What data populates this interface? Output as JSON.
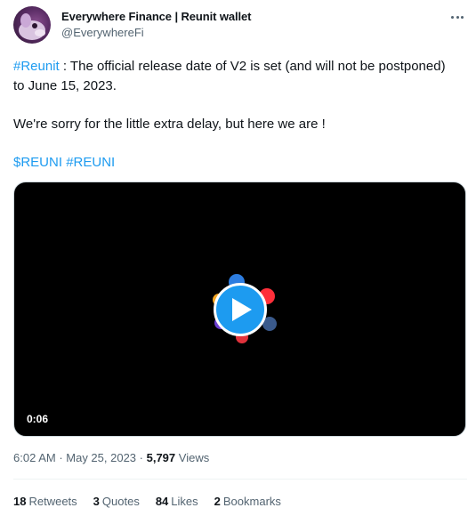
{
  "author": {
    "name": "Everywhere Finance | Reunit wallet",
    "handle": "@EverywhereFi",
    "avatar_icon": "wallet-mascot-avatar"
  },
  "menu": {
    "icon": "more-options-icon"
  },
  "tweet": {
    "hashtag": "#Reunit",
    "line1_rest": " : The official release date of V2 is set (and will not be postponed) to June 15, 2023.",
    "line2": "We're sorry for the little extra delay, but here we are !",
    "cashtag": "$REUNI",
    "hashtag2": "#REUNI"
  },
  "media": {
    "duration": "0:06",
    "play_icon": "play-icon",
    "accent": "#1d9bf0"
  },
  "meta": {
    "time": "6:02 AM",
    "sep1": " · ",
    "date": "May 25, 2023",
    "sep2": " · ",
    "views_count": "5,797",
    "views_label": " Views"
  },
  "stats": [
    {
      "count": "18",
      "label": "Retweets"
    },
    {
      "count": "3",
      "label": "Quotes"
    },
    {
      "count": "84",
      "label": "Likes"
    },
    {
      "count": "2",
      "label": "Bookmarks"
    }
  ]
}
